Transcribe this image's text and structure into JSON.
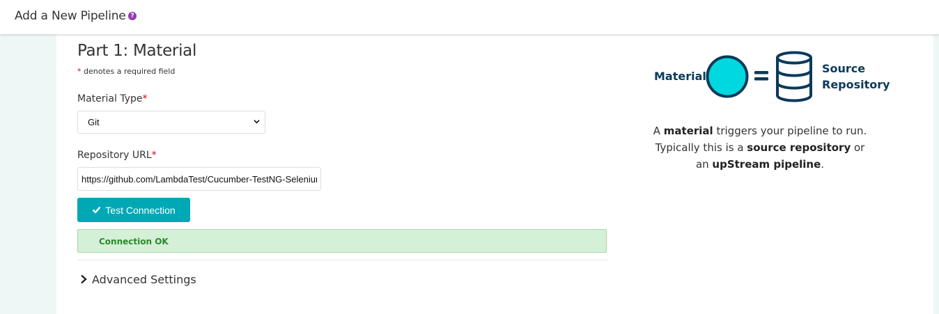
{
  "header": {
    "title": "Add a New Pipeline",
    "help_icon": "?"
  },
  "form": {
    "title": "Part 1: Material",
    "required_note_star": "*",
    "required_note": "denotes a required field",
    "material_type": {
      "label": "Material Type",
      "star": "*",
      "value": "Git"
    },
    "repo_url": {
      "label": "Repository URL",
      "star": "*",
      "value": "https://github.com/LambdaTest/Cucumber-TestNG-Selenium"
    },
    "test_button": "Test Connection",
    "connection_status": "Connection OK",
    "advanced_settings": "Advanced Settings"
  },
  "diagram": {
    "material_label": "Material",
    "source_line1": "Source",
    "source_line2": "Repository"
  },
  "explain": {
    "p1_a": "A ",
    "p1_b": "material",
    "p1_c": " triggers your pipeline to run.",
    "p2_a": "Typically this is a ",
    "p2_b": "source repository",
    "p2_c": " or",
    "p3_a": "an ",
    "p3_b": "upStream pipeline",
    "p3_c": "."
  },
  "colors": {
    "accent": "#00a8b5",
    "diagram_circle": "#00d8e0",
    "diagram_ink": "#0a3a5a",
    "success_bg": "#d4f0d6",
    "success_text": "#2a8a2a",
    "required": "#d0021b",
    "help": "#943bb3"
  }
}
